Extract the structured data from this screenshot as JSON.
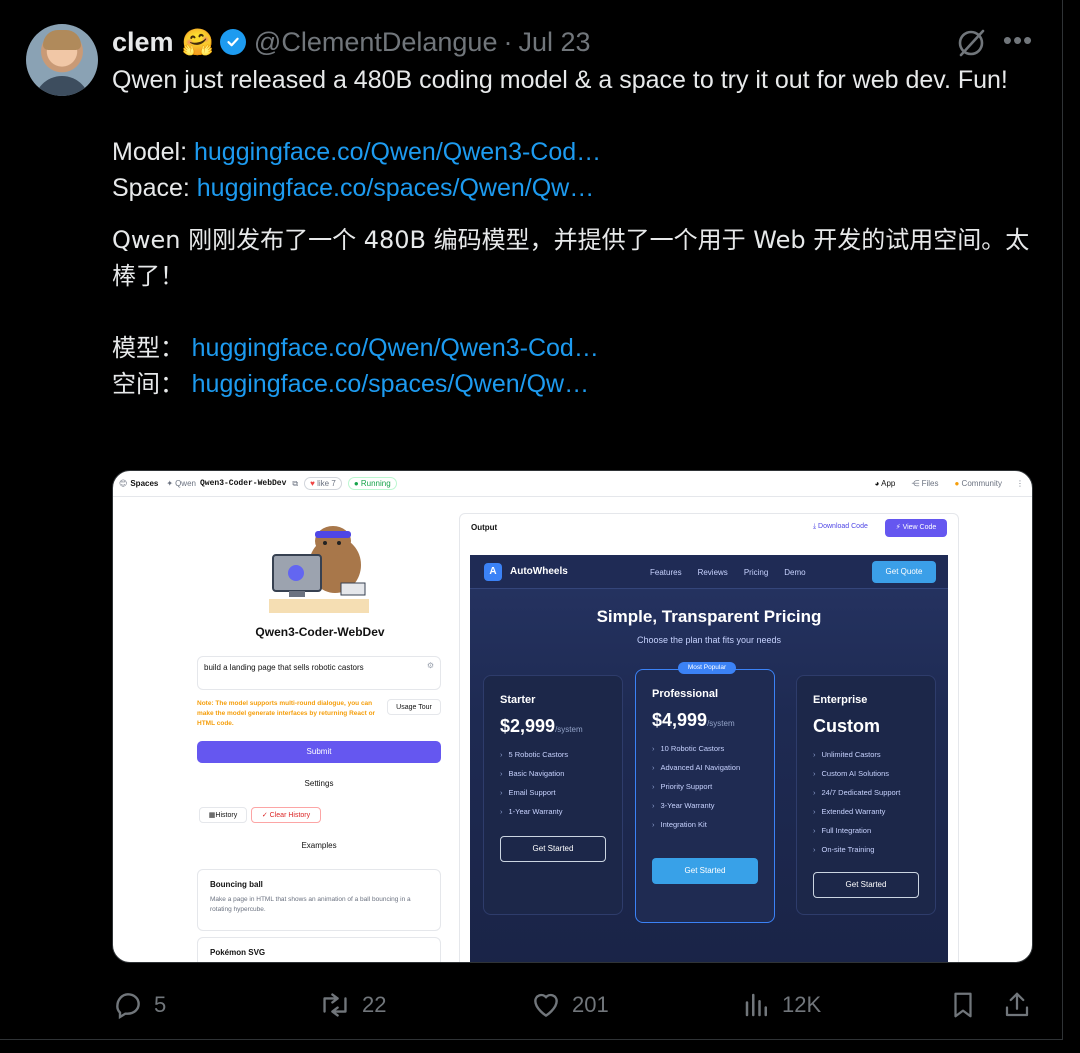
{
  "author": {
    "name": "clem",
    "emoji": "🤗",
    "handle": "@ClementDelangue",
    "separator": "·",
    "date": "Jul 23"
  },
  "tweet": {
    "line1": "Qwen just released a 480B coding model & a space to try it out for web dev. Fun!",
    "model_label": "Model: ",
    "model_link": "huggingface.co/Qwen/Qwen3-Cod…",
    "space_label": "Space: ",
    "space_link": "huggingface.co/spaces/Qwen/Qw…",
    "cn_line": "Qwen 刚刚发布了一个 480B 编码模型，并提供了一个用于 Web 开发的试用空间。太棒了！",
    "cn_model_label": "模型： ",
    "cn_model_link": "huggingface.co/Qwen/Qwen3-Cod…",
    "cn_space_label": "空间： ",
    "cn_space_link": "huggingface.co/spaces/Qwen/Qw…"
  },
  "media": {
    "topbar": {
      "spaces": "Spaces",
      "org": "Qwen",
      "repo": "Qwen3-Coder-WebDev",
      "like": "like",
      "like_count": "7",
      "status": "● Running",
      "tab_app": "App",
      "tab_files": "Files",
      "tab_community": "Community"
    },
    "left": {
      "title": "Qwen3-Coder-WebDev",
      "prompt": "build a landing page that sells robotic castors",
      "note": "Note: The model supports multi-round dialogue, you can make the model generate interfaces by returning React or HTML code.",
      "usage_tour": "Usage Tour",
      "submit": "Submit",
      "settings": "Settings",
      "history": "History",
      "clear_history": "Clear History",
      "examples": "Examples",
      "example1_title": "Bouncing ball",
      "example1_desc": "Make a page in HTML that shows an animation of a ball bouncing in a rotating hypercube.",
      "example2_title": "Pokémon SVG"
    },
    "output": {
      "label": "Output",
      "download": "Download Code",
      "view_code": "View Code"
    },
    "site": {
      "logo": "A",
      "brand": "AutoWheels",
      "nav": [
        "Features",
        "Reviews",
        "Pricing",
        "Demo"
      ],
      "cta": "Get Quote",
      "heading": "Simple, Transparent Pricing",
      "subheading": "Choose the plan that fits your needs",
      "plans": [
        {
          "name": "Starter",
          "price": "$2,999",
          "unit": "/system",
          "features": [
            "5 Robotic Castors",
            "Basic Navigation",
            "Email Support",
            "1-Year Warranty"
          ],
          "button": "Get Started"
        },
        {
          "name": "Professional",
          "badge": "Most Popular",
          "price": "$4,999",
          "unit": "/system",
          "features": [
            "10 Robotic Castors",
            "Advanced AI Navigation",
            "Priority Support",
            "3-Year Warranty",
            "Integration Kit"
          ],
          "button": "Get Started"
        },
        {
          "name": "Enterprise",
          "price": "Custom",
          "unit": "",
          "features": [
            "Unlimited Castors",
            "Custom AI Solutions",
            "24/7 Dedicated Support",
            "Extended Warranty",
            "Full Integration",
            "On-site Training"
          ],
          "button": "Get Started"
        }
      ]
    }
  },
  "actions": {
    "replies": "5",
    "reposts": "22",
    "likes": "201",
    "views": "12K"
  },
  "colors": {
    "background": "#000000",
    "text": "#e7e9ea",
    "muted": "#71767b",
    "link": "#1d9bf0"
  }
}
